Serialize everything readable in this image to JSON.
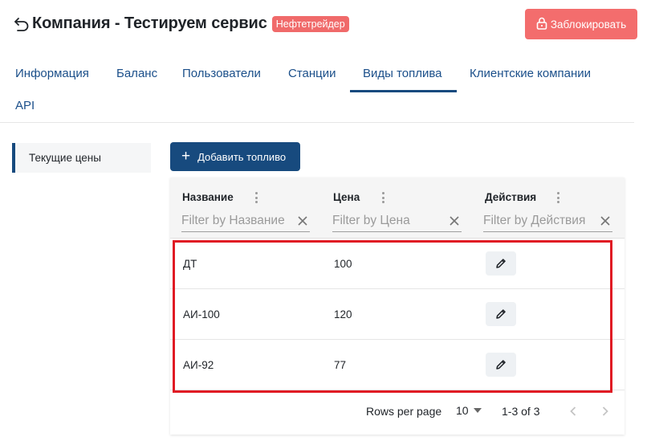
{
  "header": {
    "title": "Компания - Тестируем сервис",
    "badge": "Нефтетрейдер",
    "lock_button": "Заблокировать"
  },
  "tabs": [
    {
      "label": "Информация"
    },
    {
      "label": "Баланс"
    },
    {
      "label": "Пользователи"
    },
    {
      "label": "Станции"
    },
    {
      "label": "Виды топлива",
      "active": true
    },
    {
      "label": "Клиентские компании"
    },
    {
      "label": "API"
    }
  ],
  "sidebar": {
    "items": [
      {
        "label": "Текущие цены",
        "active": true
      }
    ]
  },
  "toolbar": {
    "add_label": "Добавить топливо"
  },
  "grid": {
    "columns": [
      {
        "title": "Название",
        "filter_placeholder": "Filter by Название"
      },
      {
        "title": "Цена",
        "filter_placeholder": "Filter by Цена"
      },
      {
        "title": "Действия",
        "filter_placeholder": "Filter by Действия"
      }
    ],
    "rows": [
      {
        "name": "ДТ",
        "price": "100"
      },
      {
        "name": "АИ-100",
        "price": "120"
      },
      {
        "name": "АИ-92",
        "price": "77"
      }
    ],
    "pagination": {
      "rows_per_page_label": "Rows per page",
      "rows_per_page": "10",
      "range": "1-3 of 3"
    }
  },
  "colors": {
    "primary": "#174a7e",
    "danger": "#f36d6d",
    "badge": "#f06a6a",
    "highlight": "#e01b24"
  },
  "icons": {
    "back": "back-arrow-icon",
    "lock": "lock-icon",
    "plus": "plus-icon",
    "column_menu": "vertical-dots-icon",
    "clear": "close-icon",
    "edit": "pencil-icon",
    "dropdown": "caret-down-icon",
    "prev": "chevron-left-icon",
    "next": "chevron-right-icon"
  }
}
